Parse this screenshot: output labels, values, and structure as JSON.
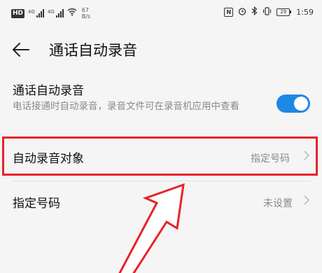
{
  "status_bar": {
    "hd": "HD",
    "sim1": "4G",
    "sim2": "4G",
    "speed_value": "67",
    "speed_unit": "B/s",
    "nfc": "N",
    "battery": "29",
    "time": "1:59"
  },
  "header": {
    "title": "通话自动录音"
  },
  "settings": {
    "auto_record": {
      "title": "通话自动录音",
      "description": "电话接通时自动录音，录音文件可在录音机应用中查看",
      "enabled": true
    },
    "record_target": {
      "title": "自动录音对象",
      "value": "指定号码"
    },
    "specified_numbers": {
      "title": "指定号码",
      "value": "未设置"
    }
  },
  "colors": {
    "accent": "#1e88e5",
    "annotation": "#e8222a"
  }
}
